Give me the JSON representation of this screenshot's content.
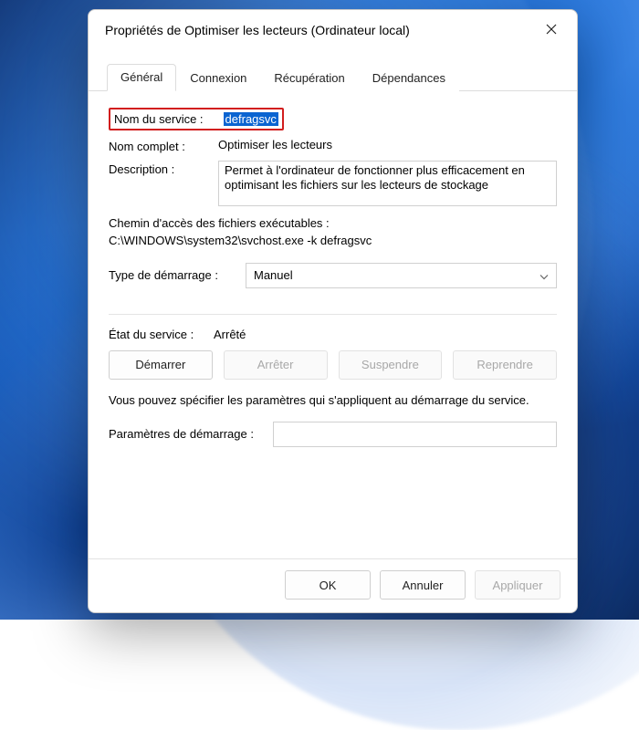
{
  "window": {
    "title": "Propriétés de Optimiser les lecteurs (Ordinateur local)"
  },
  "tabs": {
    "general": "Général",
    "logon": "Connexion",
    "recovery": "Récupération",
    "dependencies": "Dépendances"
  },
  "fields": {
    "service_name_label": "Nom du service :",
    "service_name_value": "defragsvc",
    "display_name_label": "Nom complet :",
    "display_name_value": "Optimiser les lecteurs",
    "description_label": "Description :",
    "description_value": "Permet à l'ordinateur de fonctionner plus efficacement en optimisant les fichiers sur les lecteurs de stockage",
    "exe_path_label": "Chemin d'accès des fichiers exécutables :",
    "exe_path_value": "C:\\WINDOWS\\system32\\svchost.exe -k defragsvc",
    "startup_type_label": "Type de démarrage :",
    "startup_type_value": "Manuel",
    "service_state_label": "État du service :",
    "service_state_value": "Arrêté",
    "hint": "Vous pouvez spécifier les paramètres qui s'appliquent au démarrage du service.",
    "start_params_label": "Paramètres de démarrage :",
    "start_params_value": ""
  },
  "buttons": {
    "start": "Démarrer",
    "stop": "Arrêter",
    "pause": "Suspendre",
    "resume": "Reprendre",
    "ok": "OK",
    "cancel": "Annuler",
    "apply": "Appliquer"
  }
}
